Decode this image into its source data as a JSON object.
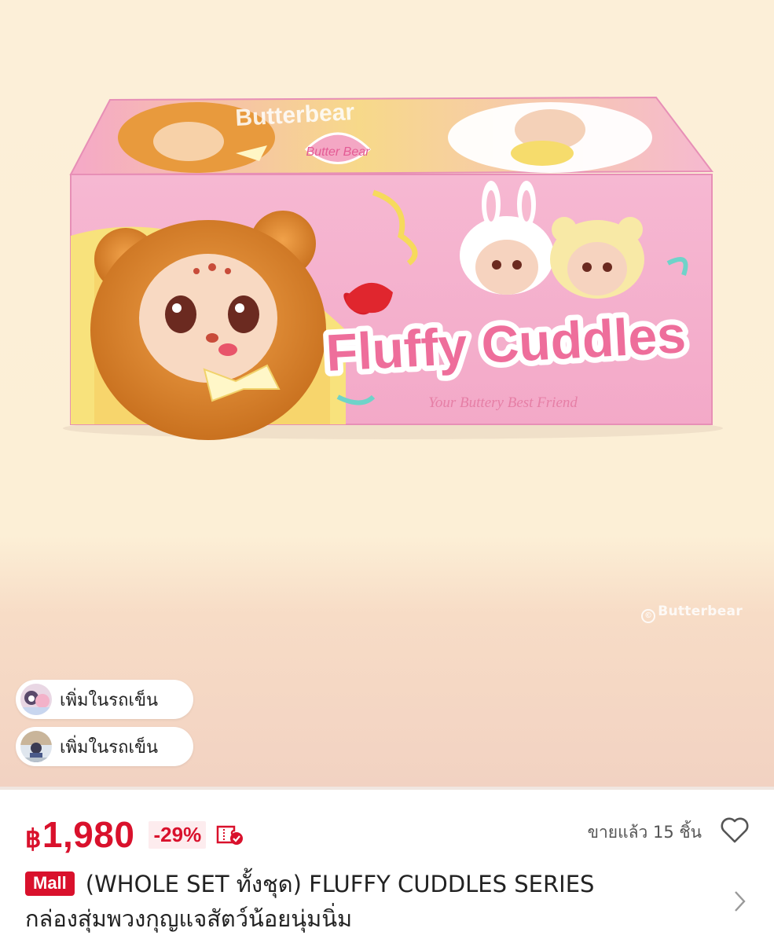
{
  "product_image": {
    "box_brand_top": "Butterbear",
    "box_heart_text": "Butter Bear",
    "box_title": "Fluffy Cuddles",
    "box_tagline": "Your Buttery Best Friend",
    "watermark": "Butterbear"
  },
  "overlay": {
    "bubbles": [
      {
        "label": "เพิ่มในรถเข็น"
      },
      {
        "label": "เพิ่มในรถเข็น"
      }
    ]
  },
  "info": {
    "currency": "฿",
    "price": "1,980",
    "discount": "-29%",
    "sold": "ขายแล้ว 15 ชิ้น",
    "mall_badge": "Mall",
    "title_line1": "(WHOLE SET ทั้งชุด) FLUFFY CUDDLES SERIES",
    "title_line2": "กล่องสุ่มพวงกุญแจสัตว์น้อยนุ่มนิ่ม"
  },
  "colors": {
    "accent": "#d9112c",
    "discount_bg": "#fdecee",
    "hero_bg": "#fcefd8"
  },
  "icons": [
    "voucher-icon",
    "heart-icon",
    "chevron-right-icon"
  ]
}
